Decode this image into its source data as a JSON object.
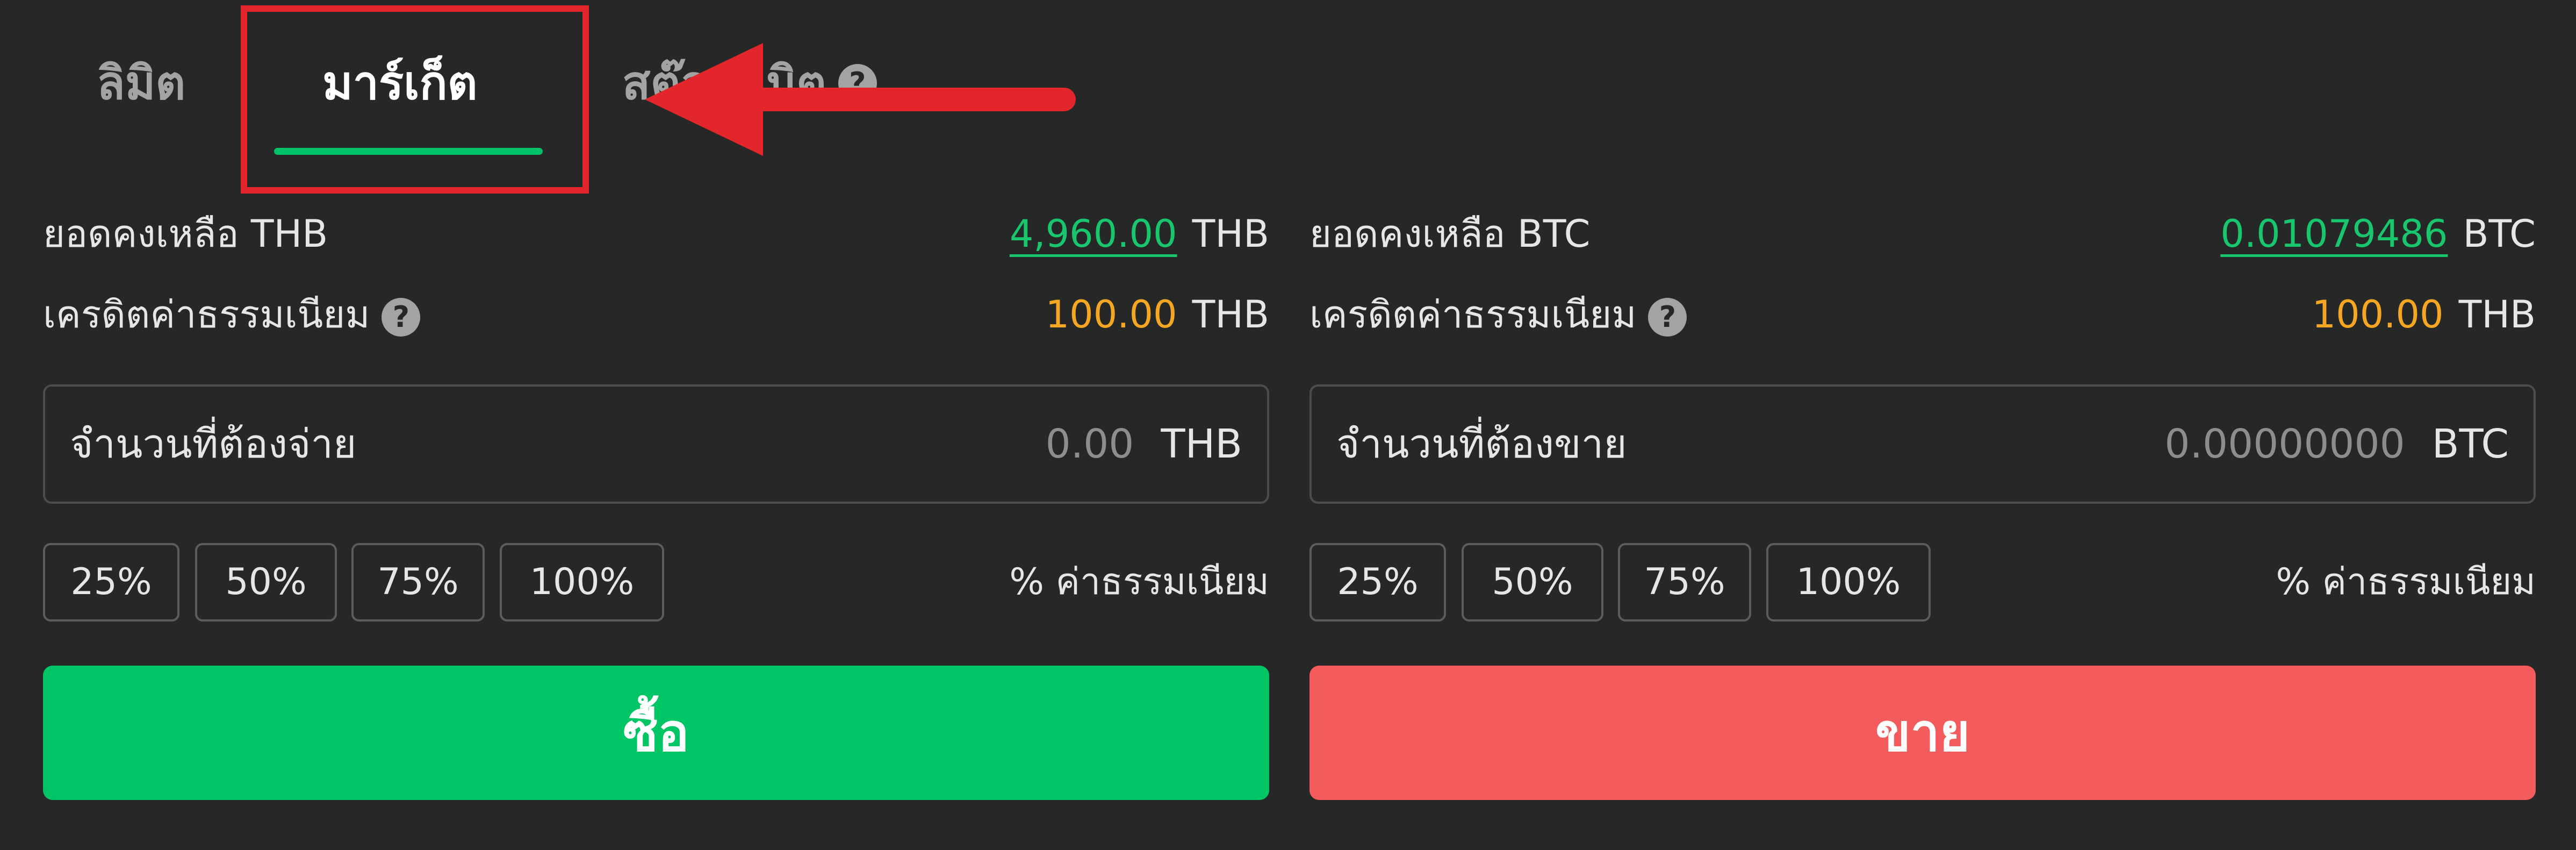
{
  "tabs": {
    "limit": "ลิมิต",
    "market": "มาร์เก็ต",
    "stop_limit": "สต๊อปลิมิต",
    "help_glyph": "?"
  },
  "annotation": {
    "highlight_color": "#e3262b",
    "arrow_icon": "arrow-left-icon"
  },
  "buy": {
    "balance_label": "ยอดคงเหลือ THB",
    "balance_value": "4,960.00",
    "balance_unit": "THB",
    "fee_credit_label": "เครดิตค่าธรรมเนียม",
    "fee_credit_value": "100.00",
    "fee_credit_unit": "THB",
    "amount_label": "จำนวนที่ต้องจ่าย",
    "amount_placeholder": "0.00",
    "amount_unit": "THB",
    "percent_options": [
      "25%",
      "50%",
      "75%",
      "100%"
    ],
    "fee_percent_label": "% ค่าธรรมเนียม",
    "action_label": "ซื้อ"
  },
  "sell": {
    "balance_label": "ยอดคงเหลือ BTC",
    "balance_value": "0.01079486",
    "balance_unit": "BTC",
    "fee_credit_label": "เครดิตค่าธรรมเนียม",
    "fee_credit_value": "100.00",
    "fee_credit_unit": "THB",
    "amount_label": "จำนวนที่ต้องขาย",
    "amount_placeholder": "0.00000000",
    "amount_unit": "BTC",
    "percent_options": [
      "25%",
      "50%",
      "75%",
      "100%"
    ],
    "fee_percent_label": "% ค่าธรรมเนียม",
    "action_label": "ขาย"
  },
  "colors": {
    "background": "#252826",
    "buy": "#00c565",
    "sell": "#f35b5d",
    "positive_value": "#19c56d",
    "fee_value": "#f5a623",
    "active_tab_underline": "#00c166"
  }
}
